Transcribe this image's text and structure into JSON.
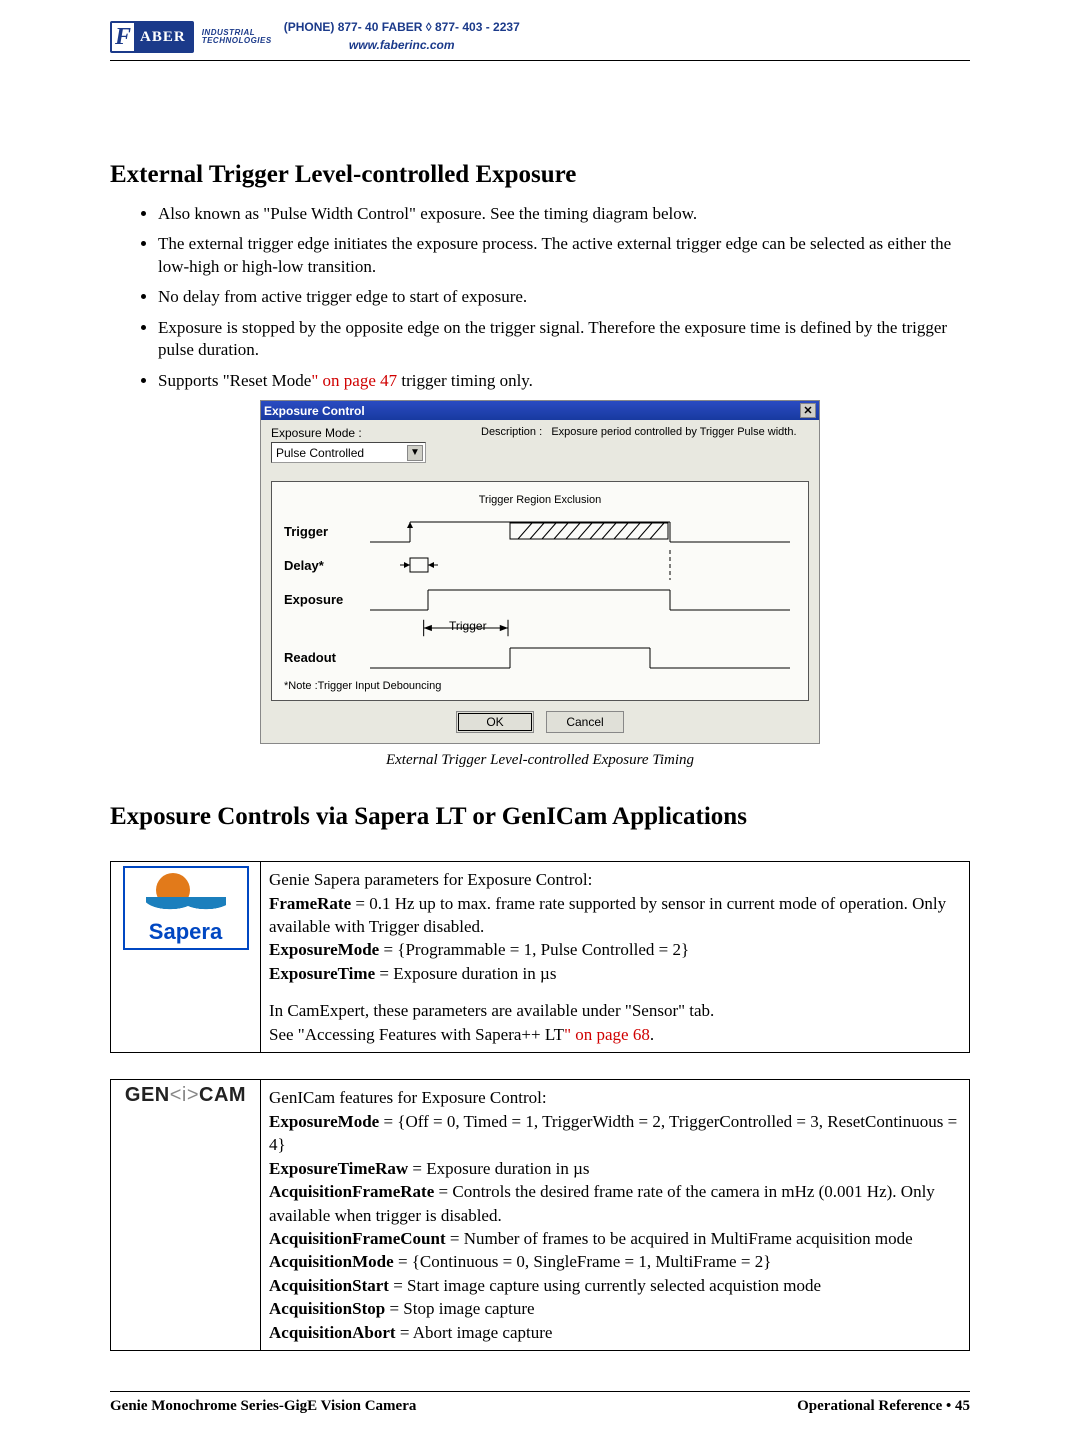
{
  "header": {
    "logo_brand": "ABER",
    "logo_sub1": "INDUSTRIAL",
    "logo_sub2": "TECHNOLOGIES",
    "phone": "(PHONE) 877- 40 FABER  ◊  877- 403 - 2237",
    "url": "www.faberinc.com"
  },
  "section1": {
    "title": "External Trigger Level-controlled Exposure",
    "bullets": [
      "Also known as \"Pulse Width Control\" exposure. See the timing diagram below.",
      "The external trigger edge initiates the exposure process. The active external trigger edge can be selected as either the low-high or high-low transition.",
      "No delay from active trigger edge to start of exposure.",
      "Exposure is stopped by the opposite edge on the trigger signal. Therefore the exposure time is defined by the trigger pulse duration."
    ],
    "bullet5_pre": "Supports \"Reset Mode",
    "bullet5_red": "\" on page 47",
    "bullet5_post": " trigger timing only."
  },
  "dialog": {
    "title": "Exposure Control",
    "exposure_mode_label": "Exposure Mode :",
    "exposure_mode_value": "Pulse Controlled",
    "description_label": "Description :",
    "description_value": "Exposure period controlled by Trigger Pulse width.",
    "panel_title": "Trigger Region Exclusion",
    "rows": {
      "r1": "Trigger",
      "r2": "Delay*",
      "r3": "Exposure",
      "r4": "Readout"
    },
    "trigger_arrow_label": "Trigger",
    "note": "*Note :Trigger Input Debouncing",
    "ok": "OK",
    "cancel": "Cancel"
  },
  "caption": "External Trigger Level-controlled Exposure Timing",
  "section2": {
    "title": "Exposure Controls via Sapera LT or GenICam Applications"
  },
  "sapera": {
    "logo_text": "Sapera",
    "line1": "Genie Sapera parameters for Exposure Control:",
    "line2a": "FrameRate",
    "line2b": " = 0.1 Hz up to max. frame rate supported by sensor in current mode of operation. Only available with Trigger disabled.",
    "line3a": "ExposureMode",
    "line3b": " = {Programmable = 1, Pulse Controlled = 2}",
    "line4a": "ExposureTime",
    "line4b": " = Exposure duration in µs",
    "line5": "In CamExpert, these parameters are available under \"Sensor\" tab.",
    "line6a": "See \"Accessing Features with Sapera++ LT",
    "line6b": "\" on page 68",
    "line6c": "."
  },
  "genicam": {
    "logo_pre": "GEN",
    "logo_i": "<i>",
    "logo_post": "CAM",
    "l1": "GenICam features for Exposure Control:",
    "l2a": "ExposureMode",
    "l2b": " = {Off = 0, Timed = 1, TriggerWidth = 2,  TriggerControlled = 3, ResetContinuous = 4}",
    "l3a": "ExposureTimeRaw",
    "l3b": " = Exposure duration in µs",
    "l4a": "AcquisitionFrameRate",
    "l4b": " = Controls the desired frame rate of the camera in mHz (0.001 Hz). Only available when trigger is disabled.",
    "l5a": "AcquisitionFrameCount",
    "l5b": " = Number of frames to be acquired in MultiFrame acquisition mode",
    "l6a": "AcquisitionMode",
    "l6b": " = {Continuous = 0, SingleFrame = 1, MultiFrame = 2}",
    "l7a": "AcquisitionStart",
    "l7b": " = Start image capture using currently selected acquistion mode",
    "l8a": "AcquisitionStop",
    "l8b": " = Stop image capture",
    "l9a": "AcquisitionAbort",
    "l9b": " = Abort image capture"
  },
  "footer": {
    "left": "Genie Monochrome Series-GigE Vision Camera",
    "right": "Operational Reference  •  45"
  }
}
